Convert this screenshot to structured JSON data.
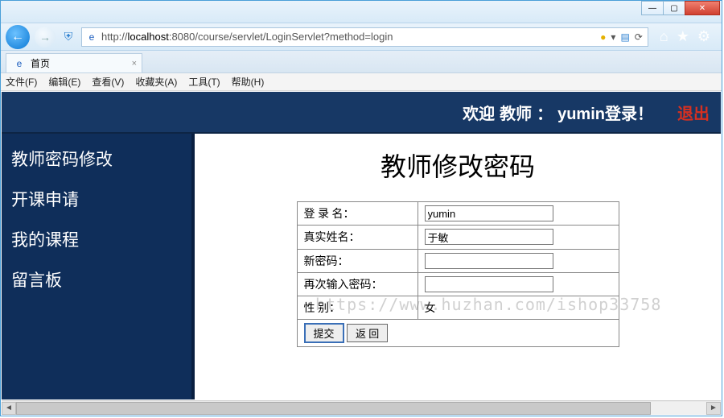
{
  "window": {
    "min_icon": "—",
    "max_icon": "▢",
    "close_icon": "✕"
  },
  "nav": {
    "back": "←",
    "fwd": "→",
    "shield": "⛨",
    "e": "e",
    "url_prefix": "http://",
    "url_host": "localhost",
    "url_rest": ":8080/course/servlet/LoginServlet?method=login",
    "warn": "●",
    "dd": "▾",
    "compat": "▤",
    "refresh": "⟳"
  },
  "toolbar_icons": {
    "home": "⌂",
    "star": "★",
    "gear": "⚙"
  },
  "tab": {
    "favicon": "e",
    "title": "首页",
    "close": "×"
  },
  "menus": [
    "文件(F)",
    "编辑(E)",
    "查看(V)",
    "收藏夹(A)",
    "工具(T)",
    "帮助(H)"
  ],
  "header": {
    "welcome": "欢迎",
    "role": "教师",
    "colon": "：",
    "user_msg": "yumin登录！",
    "logout": "退出"
  },
  "sidebar": {
    "items": [
      "教师密码修改",
      "开课申请",
      "我的课程",
      "留言板"
    ]
  },
  "page": {
    "title": "教师修改密码",
    "rows": {
      "login_label": "登 录 名：",
      "login_value": "yumin",
      "realname_label": "真实姓名：",
      "realname_value": "于敏",
      "newpwd_label": "新密码：",
      "confirm_label": "再次输入密码：",
      "gender_label": "性 别：",
      "gender_value": "女"
    },
    "buttons": {
      "submit": "提交",
      "back": "返   回"
    }
  },
  "watermark": "https://www.huzhan.com/ishop33758",
  "scroll": {
    "left": "◄",
    "right": "►"
  }
}
